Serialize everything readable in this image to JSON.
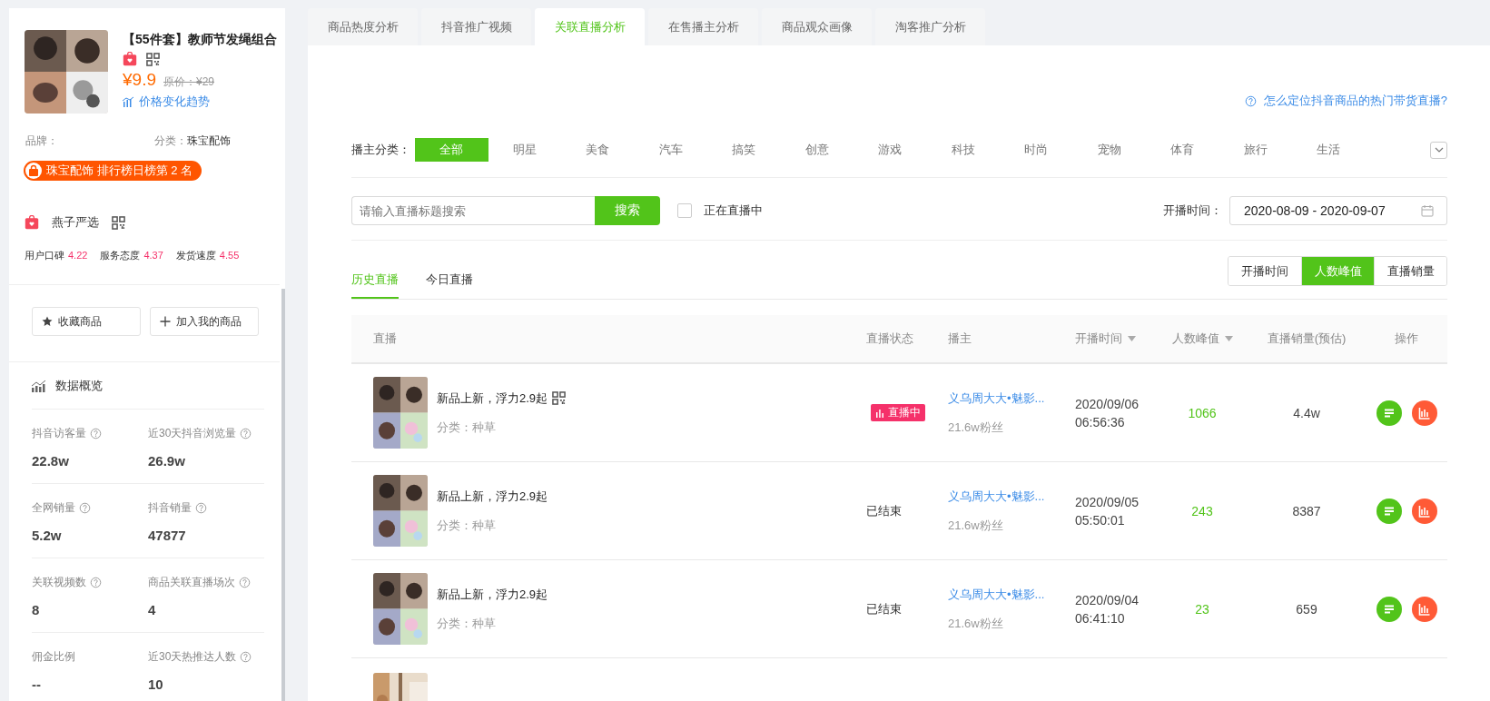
{
  "product": {
    "title": "【55件套】教师节发绳组合",
    "price": "¥9.9",
    "original_price": "原价：¥29",
    "trend_link": "价格变化趋势",
    "brand_label": "品牌：",
    "category_label": "分类：",
    "category": "珠宝配饰",
    "rank_badge": "珠宝配饰 排行榜日榜第 2 名"
  },
  "store": {
    "name": "燕子严选",
    "ratings": [
      {
        "label": "用户口碑",
        "value": "4.22"
      },
      {
        "label": "服务态度",
        "value": "4.37"
      },
      {
        "label": "发货速度",
        "value": "4.55"
      }
    ]
  },
  "actions": [
    {
      "kind": "favorite",
      "label": "收藏商品"
    },
    {
      "kind": "add",
      "label": "加入我的商品"
    }
  ],
  "overview": {
    "title": "数据概览",
    "metrics": [
      {
        "label": "抖音访客量",
        "help": true,
        "value": "22.8w"
      },
      {
        "label": "近30天抖音浏览量",
        "help": true,
        "value": "26.9w"
      },
      {
        "label": "全网销量",
        "help": true,
        "value": "5.2w"
      },
      {
        "label": "抖音销量",
        "help": true,
        "value": "47877"
      },
      {
        "label": "关联视频数",
        "help": true,
        "value": "8"
      },
      {
        "label": "商品关联直播场次",
        "help": true,
        "value": "4"
      },
      {
        "label": "佣金比例",
        "help": false,
        "value": "--"
      },
      {
        "label": "近30天热推达人数",
        "help": true,
        "value": "10"
      }
    ]
  },
  "tabs": [
    {
      "label": "商品热度分析",
      "selected": false
    },
    {
      "label": "抖音推广视频",
      "selected": false
    },
    {
      "label": "关联直播分析",
      "selected": true
    },
    {
      "label": "在售播主分析",
      "selected": false
    },
    {
      "label": "商品观众画像",
      "selected": false
    },
    {
      "label": "淘客推广分析",
      "selected": false
    }
  ],
  "help_link": "怎么定位抖音商品的热门带货直播?",
  "category_filter": {
    "label": "播主分类：",
    "items": [
      {
        "label": "全部",
        "selected": true
      },
      {
        "label": "明星",
        "selected": false
      },
      {
        "label": "美食",
        "selected": false
      },
      {
        "label": "汽车",
        "selected": false
      },
      {
        "label": "搞笑",
        "selected": false
      },
      {
        "label": "创意",
        "selected": false
      },
      {
        "label": "游戏",
        "selected": false
      },
      {
        "label": "科技",
        "selected": false
      },
      {
        "label": "时尚",
        "selected": false
      },
      {
        "label": "宠物",
        "selected": false
      },
      {
        "label": "体育",
        "selected": false
      },
      {
        "label": "旅行",
        "selected": false
      },
      {
        "label": "生活",
        "selected": false
      }
    ]
  },
  "search": {
    "placeholder": "请输入直播标题搜索",
    "button": "搜索",
    "live_only": {
      "label": "正在直播中",
      "checked": false
    }
  },
  "date_filter": {
    "label": "开播时间：",
    "value": "2020-08-09 - 2020-09-07"
  },
  "sub_tabs": [
    {
      "label": "历史直播",
      "selected": true
    },
    {
      "label": "今日直播",
      "selected": false
    }
  ],
  "sort_options": [
    {
      "label": "开播时间",
      "selected": false
    },
    {
      "label": "人数峰值",
      "selected": true
    },
    {
      "label": "直播销量",
      "selected": false
    }
  ],
  "table": {
    "columns": [
      {
        "label": "直播",
        "sortable": false
      },
      {
        "label": "直播状态",
        "sortable": false
      },
      {
        "label": "播主",
        "sortable": false
      },
      {
        "label": "开播时间",
        "sortable": true
      },
      {
        "label": "人数峰值",
        "sortable": true
      },
      {
        "label": "直播销量(预估)",
        "sortable": false
      },
      {
        "label": "操作",
        "sortable": false
      }
    ],
    "rows": [
      {
        "title": "新品上新，浮力2.9起",
        "qr": true,
        "category": "分类：种草",
        "status": {
          "kind": "live",
          "text": "直播中"
        },
        "anchor": "义乌周大大•魅影...",
        "fans": "21.6w粉丝",
        "date": "2020/09/06",
        "time": "06:56:36",
        "peak": "1066",
        "sales": "4.4w"
      },
      {
        "title": "新品上新，浮力2.9起",
        "qr": false,
        "category": "分类：种草",
        "status": {
          "kind": "ended",
          "text": "已结束"
        },
        "anchor": "义乌周大大•魅影...",
        "fans": "21.6w粉丝",
        "date": "2020/09/05",
        "time": "05:50:01",
        "peak": "243",
        "sales": "8387"
      },
      {
        "title": "新品上新，浮力2.9起",
        "qr": false,
        "category": "分类：种草",
        "status": {
          "kind": "ended",
          "text": "已结束"
        },
        "anchor": "义乌周大大•魅影...",
        "fans": "21.6w粉丝",
        "date": "2020/09/04",
        "time": "06:41:10",
        "peak": "23",
        "sales": "659"
      }
    ]
  }
}
